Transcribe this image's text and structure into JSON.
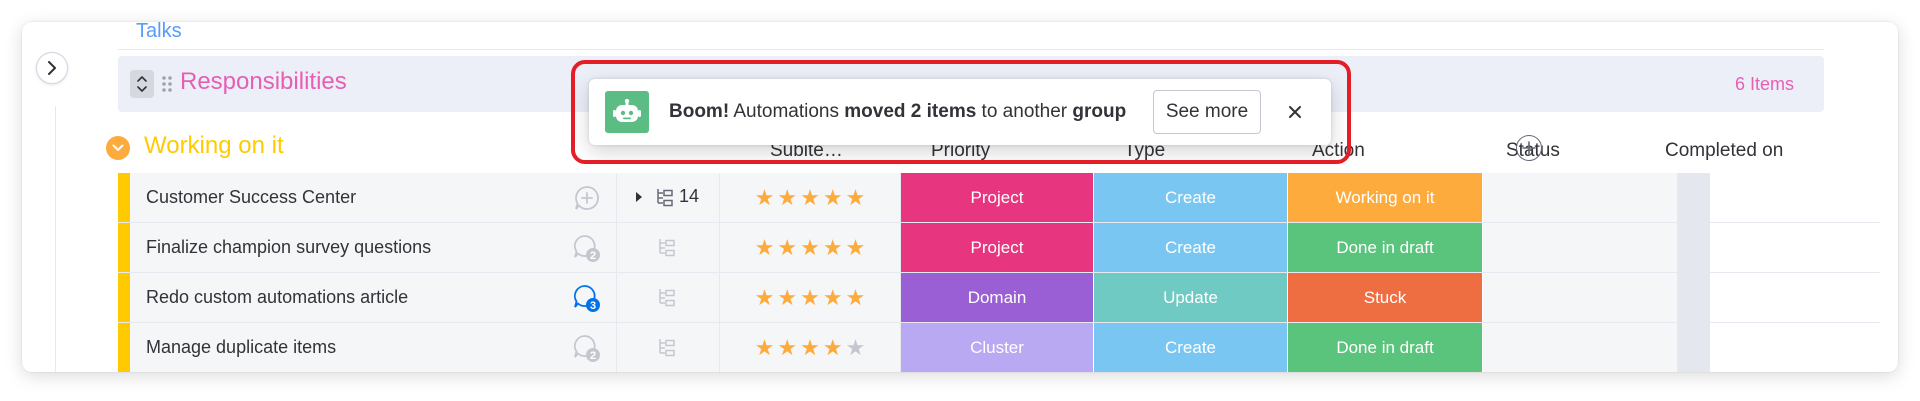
{
  "top_row": {
    "label": "Talks"
  },
  "responsibilities": {
    "title": "Responsibilities",
    "count": "6 Items"
  },
  "group": {
    "title": "Working on it",
    "color": "#ffcb00",
    "columns": {
      "subitems": "Subite…",
      "priority": "Priority",
      "type": "Type",
      "action": "Action",
      "status": "Status",
      "completed": "Completed on"
    }
  },
  "rows": [
    {
      "name": "Customer Success Center",
      "updates": "add",
      "subitems_count": "14",
      "stars": 5,
      "type": {
        "label": "Project",
        "color": "#e8357f"
      },
      "action": {
        "label": "Create",
        "color": "#79c6f3"
      },
      "status": {
        "label": "Working on it",
        "color": "#fdab3d"
      }
    },
    {
      "name": "Finalize champion survey questions",
      "updates": "2",
      "subitems_count": "",
      "stars": 5,
      "type": {
        "label": "Project",
        "color": "#e8357f"
      },
      "action": {
        "label": "Create",
        "color": "#79c6f3"
      },
      "status": {
        "label": "Done in draft",
        "color": "#5ac47d"
      }
    },
    {
      "name": "Redo custom automations article",
      "updates": "3",
      "subitems_count": "",
      "stars": 5,
      "type": {
        "label": "Domain",
        "color": "#9b5fd5"
      },
      "action": {
        "label": "Update",
        "color": "#6ecac2"
      },
      "status": {
        "label": "Stuck",
        "color": "#ee6e41"
      }
    },
    {
      "name": "Manage duplicate items",
      "updates": "2",
      "subitems_count": "",
      "stars": 4,
      "type": {
        "label": "Cluster",
        "color": "#b9a8f2"
      },
      "action": {
        "label": "Create",
        "color": "#79c6f3"
      },
      "status": {
        "label": "Done in draft",
        "color": "#5ac47d"
      }
    }
  ],
  "toast": {
    "part1": "Boom!",
    "part2": " Automations ",
    "part3": "moved 2 items",
    "part4": " to another ",
    "part5": "group",
    "see_more": "See more"
  },
  "icons": {
    "collapse": "chevron-right-icon",
    "expand": "expand-collapse-icon",
    "drag": "drag-handle-icon",
    "group_toggle": "chevron-down-icon",
    "add_column": "plus-icon",
    "conversation": "conversation-icon",
    "subitems": "subitems-icon",
    "toast_logo": "robot-icon",
    "toast_close": "close-icon"
  },
  "colors": {
    "accent_blue": "#579bfc",
    "responsibilities_pink": "#e65fb4",
    "highlight_red": "#e41e26",
    "unread_badge": "#0073ea"
  }
}
